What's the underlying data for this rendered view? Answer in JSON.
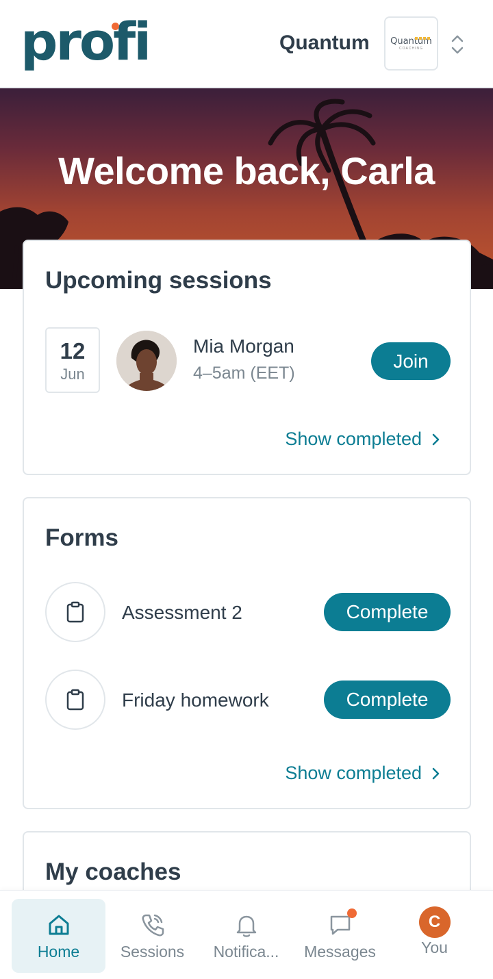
{
  "header": {
    "logo_text": "profi",
    "org_name": "Quantum",
    "org_logo_text": "Quantum",
    "org_logo_subtext": "COACHING"
  },
  "hero": {
    "title": "Welcome back, Carla"
  },
  "upcoming": {
    "title": "Upcoming sessions",
    "session": {
      "day": "12",
      "month": "Jun",
      "coach_name": "Mia Morgan",
      "time": "4–5am (EET)",
      "join_label": "Join"
    },
    "show_completed_label": "Show completed"
  },
  "forms": {
    "title": "Forms",
    "items": [
      {
        "label": "Assessment 2",
        "action_label": "Complete"
      },
      {
        "label": "Friday homework",
        "action_label": "Complete"
      }
    ],
    "show_completed_label": "Show completed"
  },
  "coaches": {
    "title": "My coaches"
  },
  "bottom_nav": {
    "items": [
      {
        "label": "Home",
        "icon": "home-icon",
        "active": true
      },
      {
        "label": "Sessions",
        "icon": "phone-icon",
        "active": false
      },
      {
        "label": "Notifica...",
        "icon": "bell-icon",
        "active": false
      },
      {
        "label": "Messages",
        "icon": "chat-icon",
        "active": false,
        "has_badge": true
      },
      {
        "label": "You",
        "icon": "avatar",
        "avatar_letter": "C",
        "active": false
      }
    ]
  },
  "colors": {
    "brand": "#1d5a6a",
    "accent": "#0c7d93",
    "notification_dot": "#f06a35",
    "user_avatar": "#d9662b"
  }
}
